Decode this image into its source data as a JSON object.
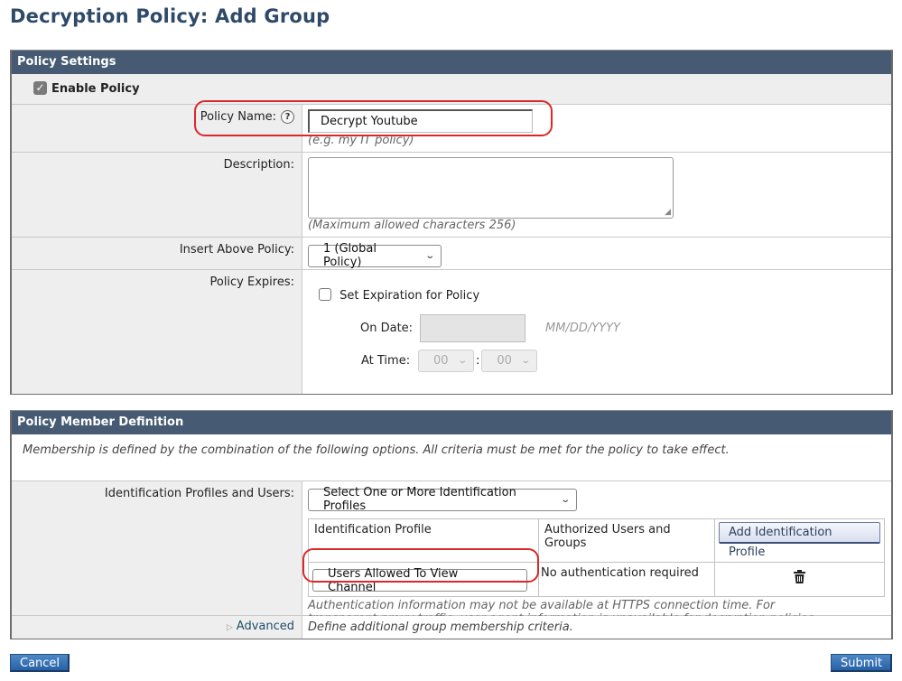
{
  "page": {
    "title": "Decryption Policy: Add Group"
  },
  "colors": {
    "header_bar": "#465b73",
    "title": "#2e4a68",
    "highlight": "#d9292b",
    "button": "#2862a6"
  },
  "policy_settings": {
    "header": "Policy Settings",
    "enable_policy": {
      "label": "Enable Policy",
      "checked": true,
      "icon": "checkbox-checked-icon"
    },
    "policy_name": {
      "label": "Policy Name:",
      "help_icon": "?",
      "value": "Decrypt Youtube",
      "hint": "(e.g. my IT policy)"
    },
    "description": {
      "label": "Description:",
      "value": "",
      "hint": "(Maximum allowed characters 256)"
    },
    "insert_above": {
      "label": "Insert Above Policy:",
      "selected": "1 (Global Policy)"
    },
    "policy_expires": {
      "label": "Policy Expires:",
      "set_expiration_label": "Set Expiration for Policy",
      "set_expiration_checked": false,
      "on_date_label": "On Date:",
      "date_value": "",
      "date_format_hint": "MM/DD/YYYY",
      "at_time_label": "At Time:",
      "hour": "00",
      "time_separator": ":",
      "minute": "00"
    }
  },
  "member_definition": {
    "header": "Policy Member Definition",
    "intro": "Membership is defined by the combination of the following options. All criteria must be met for the policy to take effect.",
    "id_profiles": {
      "label": "Identification Profiles and Users:",
      "selected": "Select One or More Identification Profiles",
      "table": {
        "col_profile": "Identification Profile",
        "col_users": "Authorized Users and Groups",
        "add_button": "Add Identification Profile",
        "rows": [
          {
            "profile": "Users Allowed To View Channel",
            "users": "No authentication required",
            "action_icon": "trash-icon"
          }
        ]
      },
      "note": "Authentication information may not be available at HTTPS connection time. For transparent proxy traffic, user agent information is unavailable for decryption policies."
    },
    "advanced": {
      "label": "Advanced",
      "description": "Define additional group membership criteria."
    }
  },
  "buttons": {
    "cancel": "Cancel",
    "submit": "Submit"
  }
}
